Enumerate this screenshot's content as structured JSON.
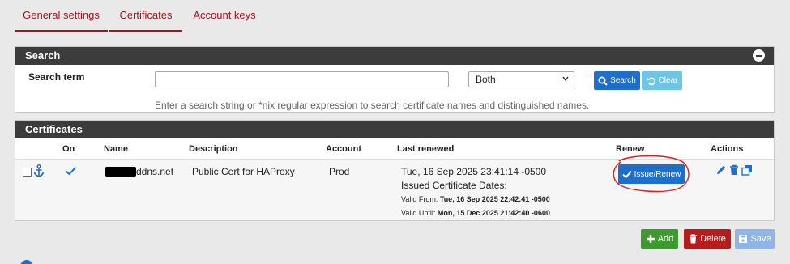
{
  "tabs": [
    {
      "label": "General settings",
      "active": true
    },
    {
      "label": "Certificates",
      "active": true
    },
    {
      "label": "Account keys",
      "active": false
    }
  ],
  "search": {
    "title": "Search",
    "term_label": "Search term",
    "term_value": "",
    "scope_selected": "Both",
    "search_button": "Search",
    "clear_button": "Clear",
    "help_text": "Enter a search string or *nix regular expression to search certificate names and distinguished names."
  },
  "certificates": {
    "title": "Certificates",
    "columns": [
      "On",
      "Name",
      "Description",
      "Account",
      "Last renewed",
      "Renew",
      "Actions"
    ],
    "rows": [
      {
        "enabled": true,
        "name_suffix": "ddns.net",
        "description": "Public Cert for HAProxy",
        "account": "Prod",
        "last_renewed": "Tue, 16 Sep 2025 23:41:14 -0500",
        "issued_dates_label": "Issued Certificate Dates:",
        "valid_from_label": "Valid From:",
        "valid_from": "Tue, 16 Sep 2025 22:42:41 -0500",
        "valid_until_label": "Valid Until:",
        "valid_until": "Mon, 15 Dec 2025 21:42:40 -0600",
        "renew_button": "Issue/Renew"
      }
    ]
  },
  "footer_buttons": {
    "add": "Add",
    "delete": "Delete",
    "save": "Save"
  },
  "colors": {
    "accent_red": "#a8131a",
    "primary_blue": "#1d6fc9",
    "success_green": "#3e9a2f",
    "danger_red": "#b71c1c",
    "panel_header": "#3c3c3c"
  }
}
